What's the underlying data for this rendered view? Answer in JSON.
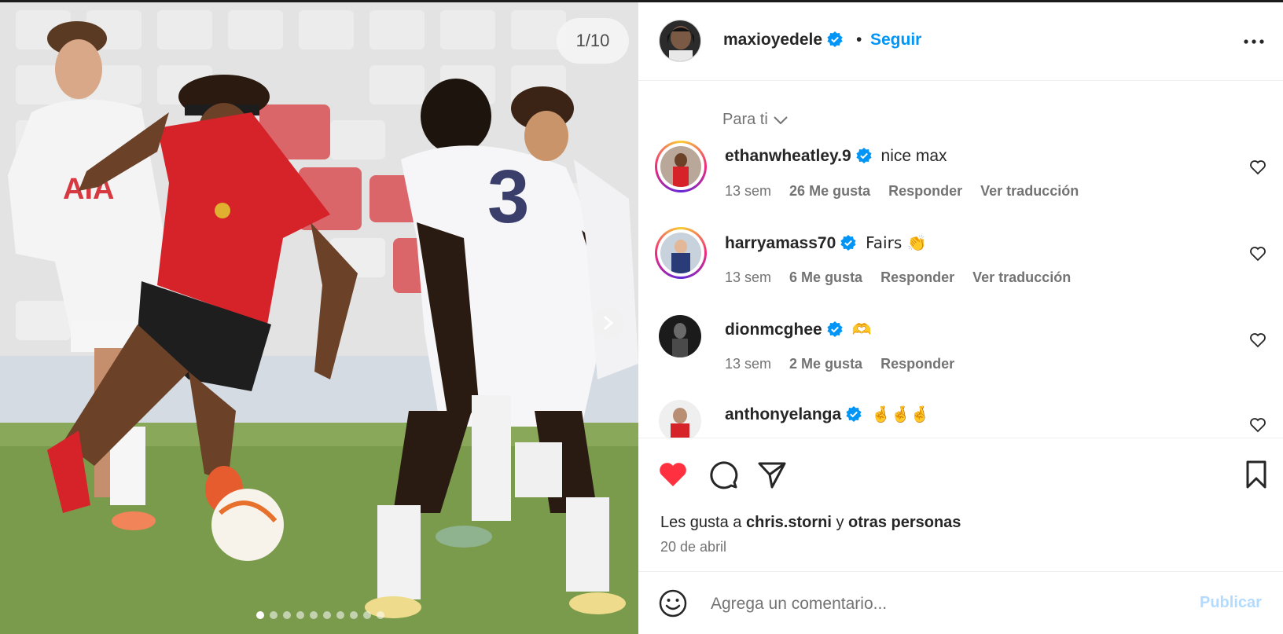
{
  "media": {
    "counter": "1/10",
    "dots_total": 10,
    "dots_active_index": 0,
    "alt": ""
  },
  "header": {
    "username": "maxioyedele",
    "separator": "•",
    "follow_label": "Seguir"
  },
  "filter": {
    "label": "Para ti"
  },
  "comments": [
    {
      "username": "ethanwheatley.9",
      "text": "nice max",
      "time": "13 sem",
      "likes": "26 Me gusta",
      "reply": "Responder",
      "translate": "Ver traducción"
    },
    {
      "username": "harryamass70",
      "text": "Fairs 👏",
      "time": "13 sem",
      "likes": "6 Me gusta",
      "reply": "Responder",
      "translate": "Ver traducción"
    },
    {
      "username": "dionmcghee",
      "text": "🫶",
      "time": "13 sem",
      "likes": "2 Me gusta",
      "reply": "Responder",
      "translate": ""
    },
    {
      "username": "anthonyelanga",
      "text": "🤞🤞🤞",
      "time": "",
      "likes": "",
      "reply": "",
      "translate": ""
    }
  ],
  "likes": {
    "prefix": "Les gusta a",
    "user": "chris.storni",
    "joiner": "y",
    "others": "otras personas"
  },
  "date": "20 de abril",
  "composer": {
    "placeholder": "Agrega un comentario...",
    "publish_label": "Publicar"
  },
  "colors": {
    "accent": "#0095f6",
    "like_red": "#ff3040",
    "publish_disabled": "#b3dbff",
    "jersey_red": "#d6232a"
  }
}
